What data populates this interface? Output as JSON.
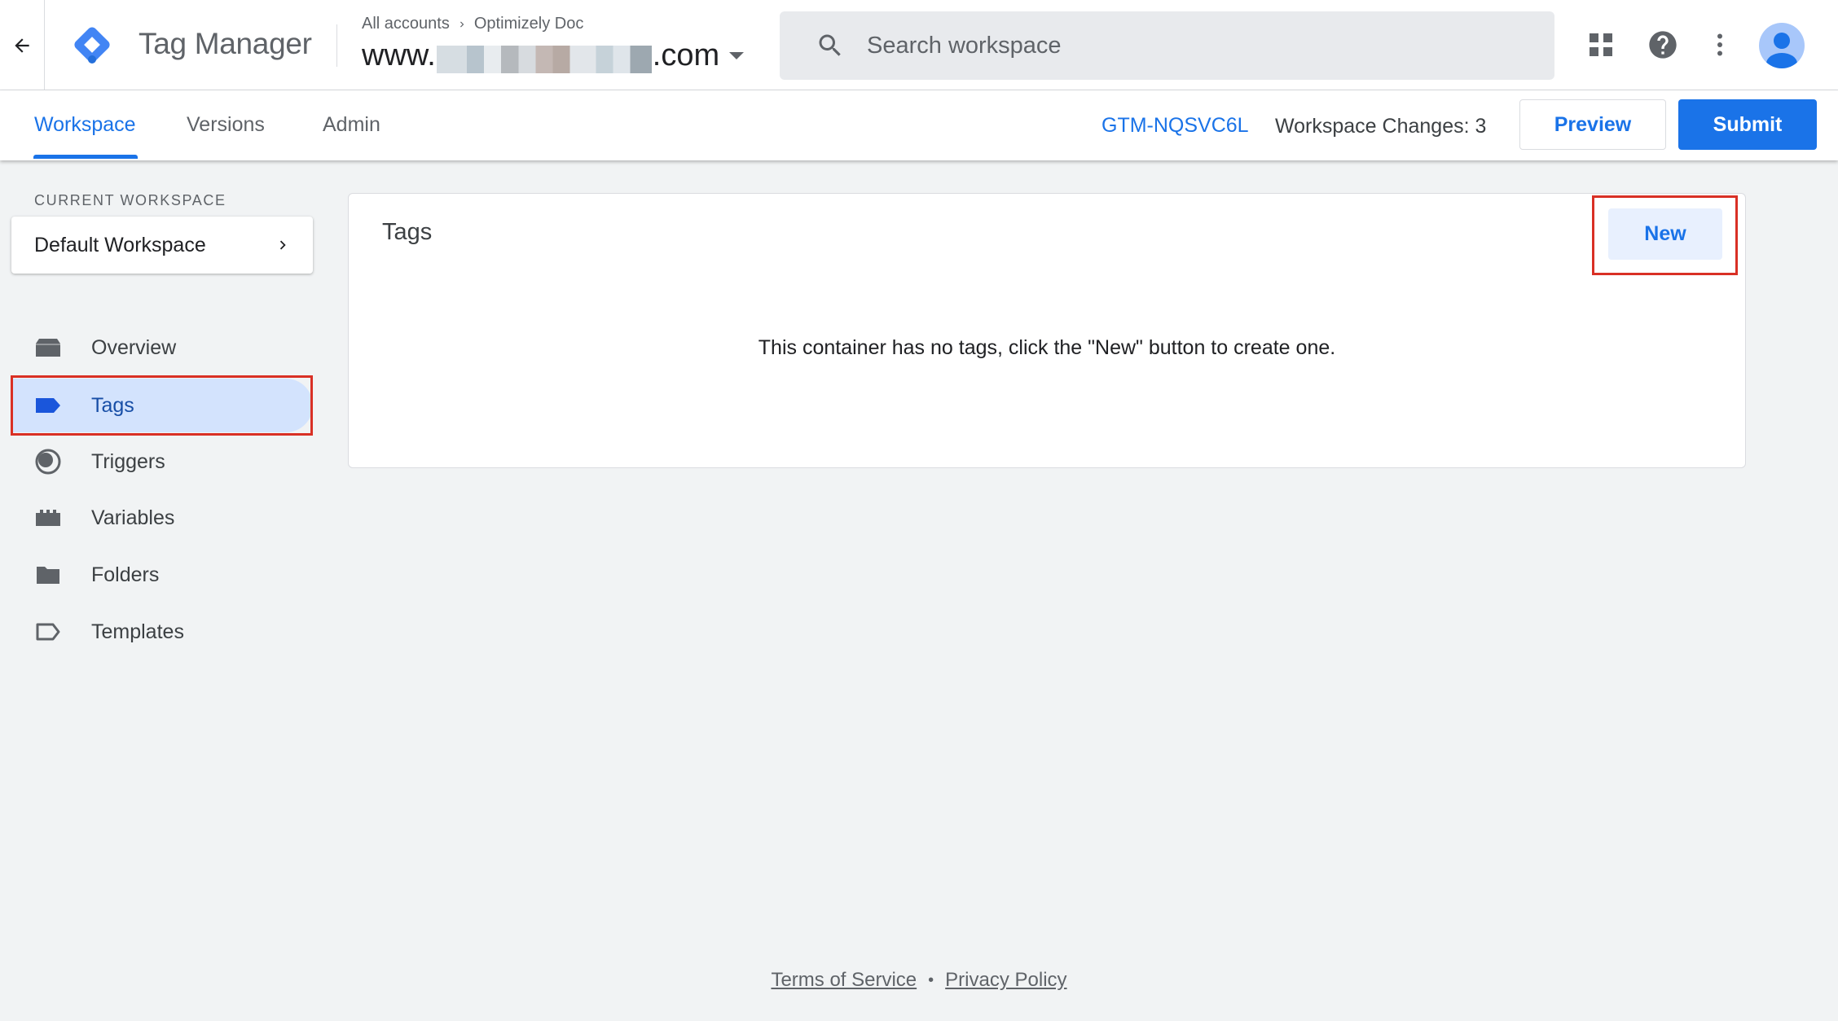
{
  "app": {
    "title": "Tag Manager"
  },
  "breadcrumb": {
    "root": "All accounts",
    "account": "Optimizely Doc"
  },
  "container": {
    "prefix": "www.",
    "suffix": ".com"
  },
  "search": {
    "placeholder": "Search workspace"
  },
  "icons": {
    "back": "arrow-left-icon",
    "logo": "tag-manager-logo",
    "search": "search-icon",
    "apps": "apps-grid-icon",
    "help": "help-icon",
    "more": "more-vert-icon",
    "account": "account-avatar"
  },
  "tabs": [
    {
      "label": "Workspace",
      "active": true
    },
    {
      "label": "Versions",
      "active": false
    },
    {
      "label": "Admin",
      "active": false
    }
  ],
  "container_id": "GTM-NQSVC6L",
  "workspace_changes": "Workspace Changes: 3",
  "actions": {
    "preview": "Preview",
    "submit": "Submit"
  },
  "sidebar": {
    "current_workspace_label": "CURRENT WORKSPACE",
    "current_workspace": "Default Workspace",
    "items": [
      {
        "label": "Overview",
        "icon": "overview-icon",
        "active": false
      },
      {
        "label": "Tags",
        "icon": "tag-icon",
        "active": true
      },
      {
        "label": "Triggers",
        "icon": "trigger-icon",
        "active": false
      },
      {
        "label": "Variables",
        "icon": "variables-icon",
        "active": false
      },
      {
        "label": "Folders",
        "icon": "folder-icon",
        "active": false
      },
      {
        "label": "Templates",
        "icon": "template-icon",
        "active": false
      }
    ]
  },
  "main": {
    "title": "Tags",
    "new_button": "New",
    "empty_message": "This container has no tags, click the \"New\" button to create one."
  },
  "footer": {
    "terms": "Terms of Service",
    "separator": "•",
    "privacy": "Privacy Policy"
  },
  "colors": {
    "accent": "#1a73e8",
    "highlight": "#d93025",
    "active_nav_bg": "#d3e3fd"
  }
}
